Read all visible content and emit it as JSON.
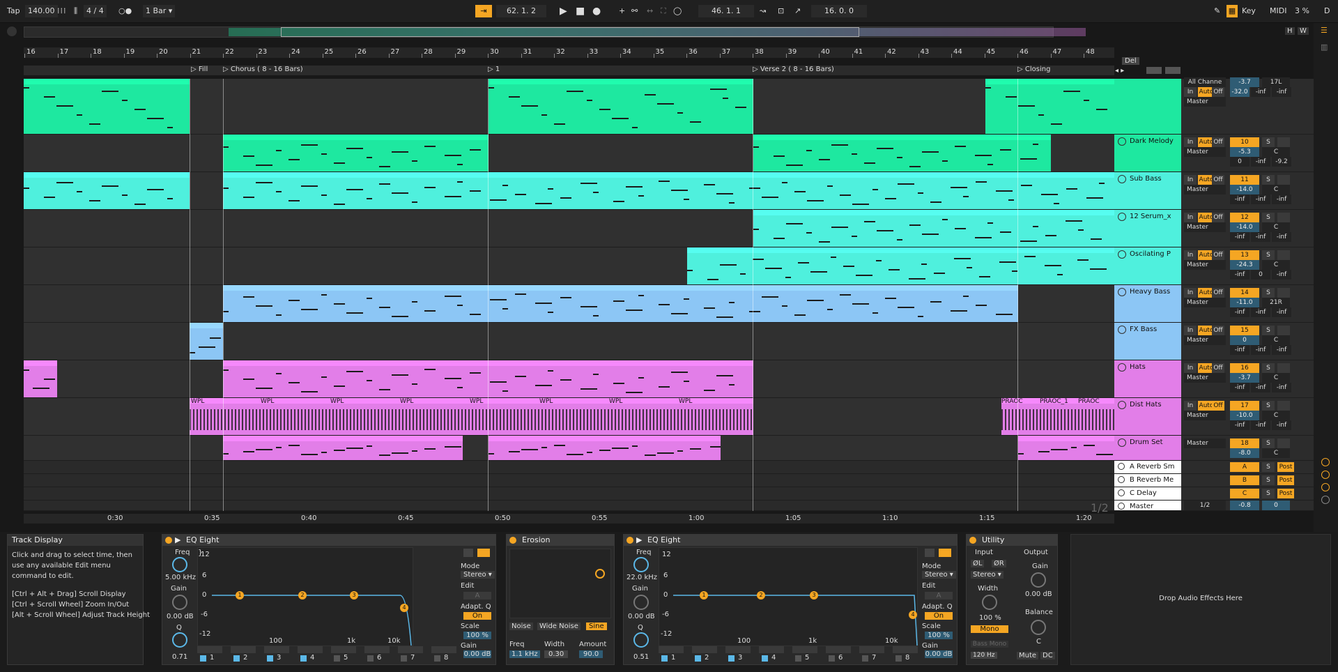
{
  "transport": {
    "tap": "Tap",
    "tempo": "140.00",
    "time_signature": "4 / 4",
    "quantize": "1 Bar",
    "position": "62. 1. 2",
    "loop_start": "46. 1. 1",
    "loop_length": "16. 0. 0",
    "key_label": "Key",
    "midi_label": "MIDI",
    "cpu": "3 %",
    "d_label": "D"
  },
  "overview": {
    "h": "H",
    "w": "W"
  },
  "ruler": {
    "bars": [
      "16",
      "17",
      "18",
      "19",
      "20",
      "21",
      "22",
      "23",
      "24",
      "25",
      "26",
      "27",
      "28",
      "29",
      "30",
      "31",
      "32",
      "33",
      "34",
      "35",
      "36",
      "37",
      "38",
      "39",
      "40",
      "41",
      "42",
      "43",
      "44",
      "45",
      "46",
      "47",
      "48"
    ]
  },
  "locators": [
    {
      "label": "Fill"
    },
    {
      "label": "Chorus ( 8 - 16 Bars)"
    },
    {
      "label": "1"
    },
    {
      "label": "Verse 2 ( 8 - 16 Bars)"
    },
    {
      "label": "Closing"
    }
  ],
  "locator_controls": {
    "del": "Del"
  },
  "timeline": {
    "ticks": [
      "0:30",
      "0:35",
      "0:40",
      "0:45",
      "0:50",
      "0:55",
      "1:00",
      "1:05",
      "1:10",
      "1:15",
      "1:20"
    ],
    "page": "1/2"
  },
  "tracks": [
    {
      "name": "",
      "input": "All Channe",
      "monitor": [
        "In",
        "Auto",
        "Off"
      ],
      "output": "Master",
      "number": "",
      "vol": "-3.7",
      "pan": "17L",
      "peak": [
        "-32.0",
        "-inf",
        "-inf"
      ],
      "color": "#1ee8a0"
    },
    {
      "name": "Dark Melody",
      "monitor": [
        "In",
        "Auto",
        "Off"
      ],
      "output": "Master",
      "number": "10",
      "vol": "-5.3",
      "pan": "C",
      "peak": [
        "0",
        "-inf",
        "-9.2"
      ],
      "color": "#1ee8a0"
    },
    {
      "name": "Sub Bass",
      "monitor": [
        "In",
        "Auto",
        "Off"
      ],
      "output": "Master",
      "number": "11",
      "vol": "-14.0",
      "pan": "C",
      "peak": [
        "-inf",
        "-inf",
        "-inf"
      ],
      "color": "#4ff0dd"
    },
    {
      "name": "12 Serum_x",
      "monitor": [
        "In",
        "Auto",
        "Off"
      ],
      "output": "Master",
      "number": "12",
      "vol": "-14.0",
      "pan": "C",
      "peak": [
        "-inf",
        "-inf",
        "-inf"
      ],
      "color": "#4ff0dd"
    },
    {
      "name": "Oscilating P",
      "monitor": [
        "In",
        "Auto",
        "Off"
      ],
      "output": "Master",
      "number": "13",
      "vol": "-24.3",
      "pan": "C",
      "peak": [
        "-inf",
        "0",
        "-inf"
      ],
      "color": "#4ff0dd"
    },
    {
      "name": "Heavy Bass",
      "monitor": [
        "In",
        "Auto",
        "Off"
      ],
      "output": "Master",
      "number": "14",
      "vol": "-11.0",
      "pan": "21R",
      "peak": [
        "-inf",
        "-inf",
        "-inf"
      ],
      "color": "#8cc6f5"
    },
    {
      "name": "FX Bass",
      "monitor": [
        "In",
        "Auto",
        "Off"
      ],
      "output": "Master",
      "number": "15",
      "vol": "0",
      "pan": "C",
      "peak": [
        "-inf",
        "-inf",
        "-inf"
      ],
      "color": "#8cc6f5"
    },
    {
      "name": "Hats",
      "monitor": [
        "In",
        "Auto",
        "Off"
      ],
      "output": "Master",
      "number": "16",
      "vol": "-3.7",
      "pan": "C",
      "peak": [
        "-inf",
        "-inf",
        "-inf"
      ],
      "color": "#e27ee8"
    },
    {
      "name": "Dist Hats",
      "monitor": [
        "In",
        "Auto",
        "Off"
      ],
      "output": "Master",
      "number": "17",
      "vol": "-10.0",
      "pan": "C",
      "peak": [
        "-inf",
        "-inf",
        "-inf"
      ],
      "color": "#e27ee8"
    },
    {
      "name": "Drum Set",
      "output": "Master",
      "number": "18",
      "vol": "-8.0",
      "pan": "C",
      "color": "#e27ee8"
    }
  ],
  "returns": [
    {
      "name": "A Reverb Sm",
      "letter": "A",
      "s": "S",
      "post": "Post"
    },
    {
      "name": "B Reverb Me",
      "letter": "B",
      "s": "S",
      "post": "Post"
    },
    {
      "name": "C Delay",
      "letter": "C",
      "s": "S",
      "post": "Post"
    },
    {
      "name": "Master",
      "output": "1/2",
      "vol": "-0.8",
      "pan": "0"
    }
  ],
  "dist_hats_clips": [
    "WPL",
    "WPL",
    "WPL",
    "WPL",
    "WPL",
    "WPL",
    "WPL",
    "WPL",
    "PRAOC",
    "PRAOC_1",
    "PRAOC"
  ],
  "monitor_letter": "S",
  "info": {
    "title": "Track Display",
    "body": "Click and drag to select time, then use any available Edit menu command to edit.",
    "shortcut1": "[Ctrl + Alt + Drag] Scroll Display",
    "shortcut2": "[Ctrl + Scroll Wheel] Zoom In/Out",
    "shortcut3": "[Alt + Scroll Wheel] Adjust Track Height"
  },
  "eq1": {
    "title": "EQ Eight",
    "freq_label": "Freq",
    "freq": "5.00 kHz",
    "gain_label": "Gain",
    "gain": "0.00 dB",
    "q_label": "Q",
    "q": "0.71",
    "db_ticks": [
      "12",
      "6",
      "0",
      "-6",
      "-12"
    ],
    "freq_ticks": [
      "100",
      "1k",
      "10k"
    ],
    "mode_label": "Mode",
    "mode": "Stereo",
    "edit_label": "Edit",
    "edit_value": "A",
    "adaptq_label": "Adapt. Q",
    "adaptq": "On",
    "scale_label": "Scale",
    "scale": "100 %",
    "gain2_label": "Gain",
    "gain2": "0.00 dB",
    "bands": [
      "1",
      "2",
      "3",
      "4",
      "5",
      "6",
      "7",
      "8"
    ],
    "nodes": [
      "1",
      "2",
      "3",
      "4"
    ]
  },
  "erosion": {
    "title": "Erosion",
    "modes": [
      "Noise",
      "Wide Noise",
      "Sine"
    ],
    "freq_label": "Freq",
    "freq": "1.1 kHz",
    "width_label": "Width",
    "width": "0.30",
    "amount_label": "Amount",
    "amount": "90.0"
  },
  "eq2": {
    "title": "EQ Eight",
    "freq_label": "Freq",
    "freq": "22.0 kHz",
    "gain_label": "Gain",
    "gain": "0.00 dB",
    "q_label": "Q",
    "q": "0.51",
    "db_ticks": [
      "12",
      "6",
      "0",
      "-6",
      "-12"
    ],
    "freq_ticks": [
      "100",
      "1k",
      "10k"
    ],
    "mode_label": "Mode",
    "mode": "Stereo",
    "edit_label": "Edit",
    "edit_value": "A",
    "adaptq_label": "Adapt. Q",
    "adaptq": "On",
    "scale_label": "Scale",
    "scale": "100 %",
    "gain2_label": "Gain",
    "gain2": "0.00 dB",
    "bands": [
      "1",
      "2",
      "3",
      "4",
      "5",
      "6",
      "7",
      "8"
    ],
    "nodes": [
      "1",
      "2",
      "3",
      "4"
    ]
  },
  "utility": {
    "title": "Utility",
    "input_label": "Input",
    "output_label": "Output",
    "phase_l": "ØL",
    "phase_r": "ØR",
    "channel": "Stereo",
    "width_label": "Width",
    "width": "100 %",
    "mono": "Mono",
    "bass_mono": "Bass Mono",
    "bass_freq": "120 Hz",
    "gain_label": "Gain",
    "gain": "0.00 dB",
    "balance_label": "Balance",
    "balance": "C",
    "mute": "Mute",
    "dc": "DC"
  },
  "drop": {
    "text": "Drop Audio Effects Here"
  },
  "colors": {
    "orange": "#f5a623",
    "green": "#1ee8a0",
    "cyan": "#4ff0dd",
    "blue": "#8cc6f5",
    "pink": "#e27ee8"
  }
}
